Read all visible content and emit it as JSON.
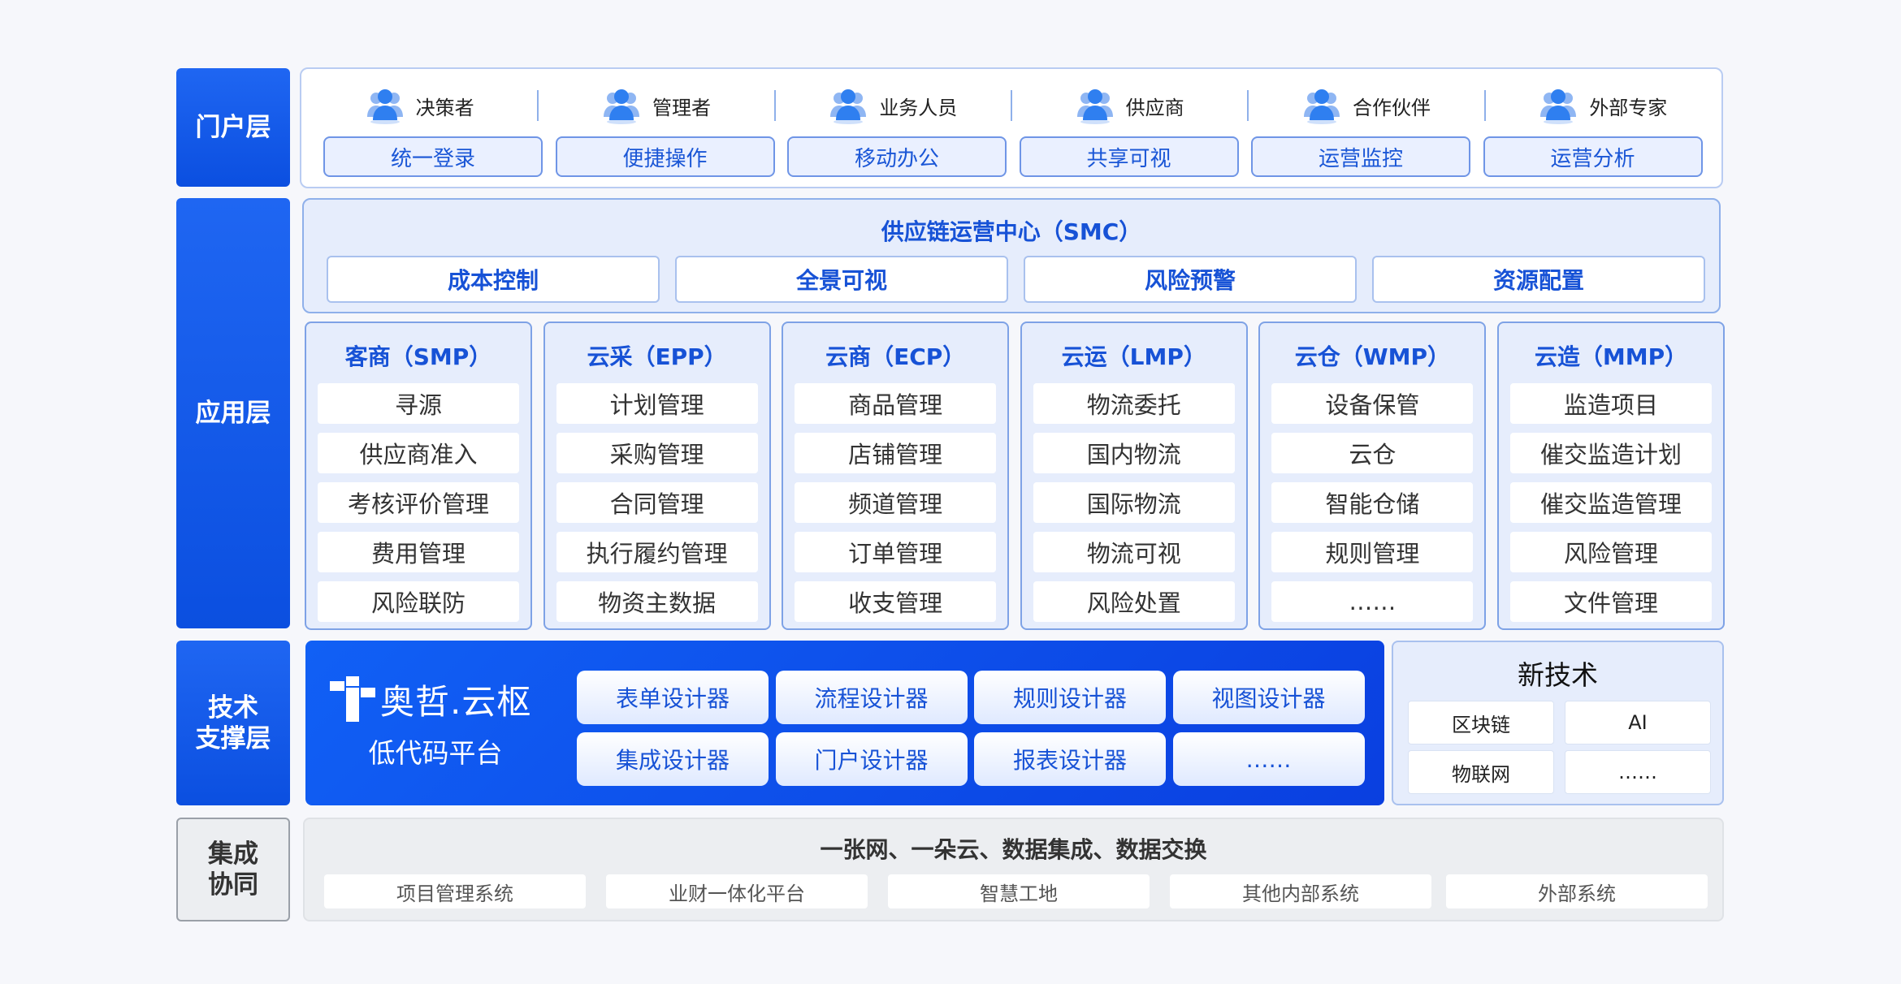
{
  "layers": {
    "portal": "门户层",
    "application": "应用层",
    "tech": "技术\n支撑层",
    "integration": "集成\n协同"
  },
  "portal": {
    "roles": [
      "决策者",
      "管理者",
      "业务人员",
      "供应商",
      "合作伙伴",
      "外部专家"
    ],
    "features": [
      "统一登录",
      "便捷操作",
      "移动办公",
      "共享可视",
      "运营监控",
      "运营分析"
    ]
  },
  "smc": {
    "title": "供应链运营中心（SMC）",
    "items": [
      "成本控制",
      "全景可视",
      "风险预警",
      "资源配置"
    ]
  },
  "modules": [
    {
      "title": "客商（SMP）",
      "items": [
        "寻源",
        "供应商准入",
        "考核评价管理",
        "费用管理",
        "风险联防"
      ]
    },
    {
      "title": "云采（EPP）",
      "items": [
        "计划管理",
        "采购管理",
        "合同管理",
        "执行履约管理",
        "物资主数据"
      ]
    },
    {
      "title": "云商（ECP）",
      "items": [
        "商品管理",
        "店铺管理",
        "频道管理",
        "订单管理",
        "收支管理"
      ]
    },
    {
      "title": "云运（LMP）",
      "items": [
        "物流委托",
        "国内物流",
        "国际物流",
        "物流可视",
        "风险处置"
      ]
    },
    {
      "title": "云仓（WMP）",
      "items": [
        "设备保管",
        "云仓",
        "智能仓储",
        "规则管理",
        "……"
      ]
    },
    {
      "title": "云造（MMP）",
      "items": [
        "监造项目",
        "催交监造计划",
        "催交监造管理",
        "风险管理",
        "文件管理"
      ]
    }
  ],
  "lowcode": {
    "brand": "奥哲.云枢",
    "subtitle": "低代码平台",
    "designers": [
      "表单设计器",
      "流程设计器",
      "规则设计器",
      "视图设计器",
      "集成设计器",
      "门户设计器",
      "报表设计器",
      "……"
    ]
  },
  "newtech": {
    "title": "新技术",
    "items": [
      "区块链",
      "AI",
      "物联网",
      "……"
    ]
  },
  "integration": {
    "title": "一张网、一朵云、数据集成、数据交换",
    "items": [
      "项目管理系统",
      "业财一体化平台",
      "智慧工地",
      "其他内部系统",
      "外部系统"
    ]
  },
  "colors": {
    "accent": "#1752d6",
    "primary": "#0b4fe0",
    "panel": "#e6edfc"
  },
  "icons": {
    "role": "user-group-icon",
    "brand": "aozhe-logo-icon"
  }
}
